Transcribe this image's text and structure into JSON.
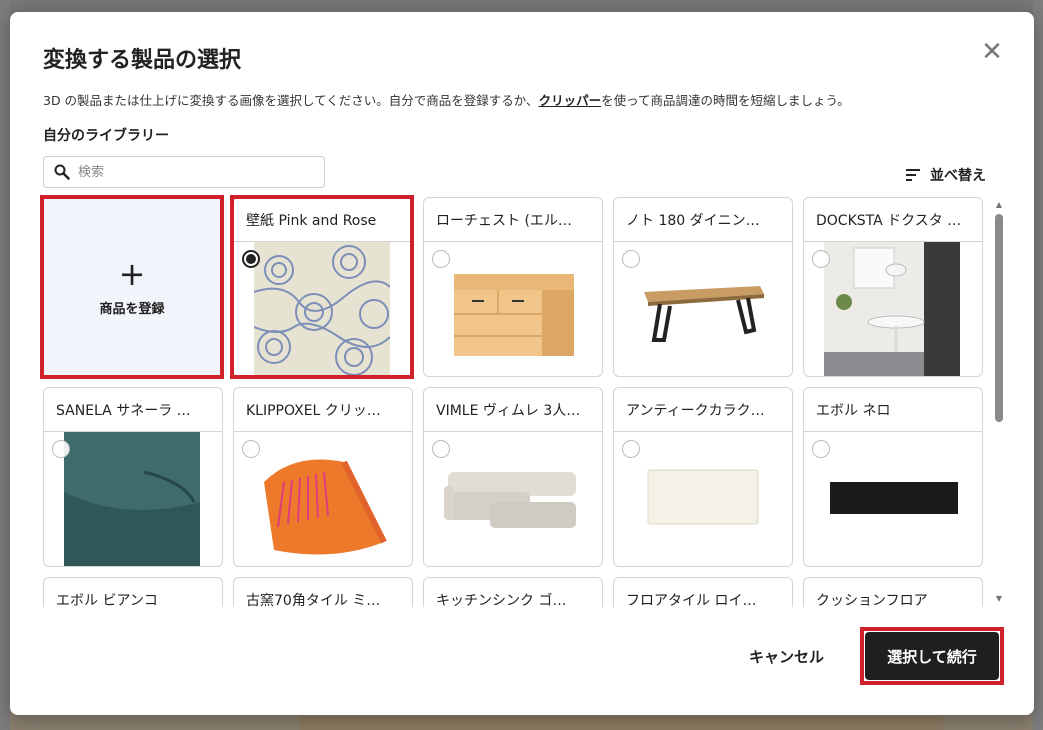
{
  "dialog": {
    "title": "変換する製品の選択",
    "description_before_link": "3D の製品または仕上げに変換する画像を選択してください。自分で商品を登録するか、",
    "link": "クリッパー",
    "description_after_link": "を使って商品調達の時間を短縮しましょう。",
    "library_heading": "自分のライブラリー",
    "search_placeholder": "検索",
    "sort_label": "並べ替え",
    "add_product_label": "商品を登録",
    "cancel_label": "キャンセル",
    "continue_label": "選択して続行"
  },
  "products": [
    {
      "title": "壁紙 Pink and Rose",
      "image": "wallpaper-pattern",
      "selected": true
    },
    {
      "title": "ローチェスト (エル…",
      "image": "chest-of-drawers",
      "selected": false
    },
    {
      "title": "ノト 180 ダイニン…",
      "image": "dining-table",
      "selected": false
    },
    {
      "title": "DOCKSTA ドクスタ …",
      "image": "dining-room",
      "selected": false
    },
    {
      "title": "SANELA サネーラ …",
      "image": "teal-cushion",
      "selected": false
    },
    {
      "title": "KLIPPOXEL クリッ…",
      "image": "orange-throw",
      "selected": false
    },
    {
      "title": "VIMLE ヴィムレ 3人…",
      "image": "sofa",
      "selected": false
    },
    {
      "title": "アンティークカラク…",
      "image": "white-tile",
      "selected": false
    },
    {
      "title": "エボル ネロ",
      "image": "black-tile",
      "selected": false
    },
    {
      "title": "エボル ビアンコ",
      "image": "",
      "selected": false
    },
    {
      "title": "古窯70角タイル ミ…",
      "image": "",
      "selected": false
    },
    {
      "title": "キッチンシンク ゴ…",
      "image": "",
      "selected": false
    },
    {
      "title": "フロアタイル ロイ…",
      "image": "",
      "selected": false
    },
    {
      "title": "クッションフロア",
      "image": "",
      "selected": false
    }
  ]
}
